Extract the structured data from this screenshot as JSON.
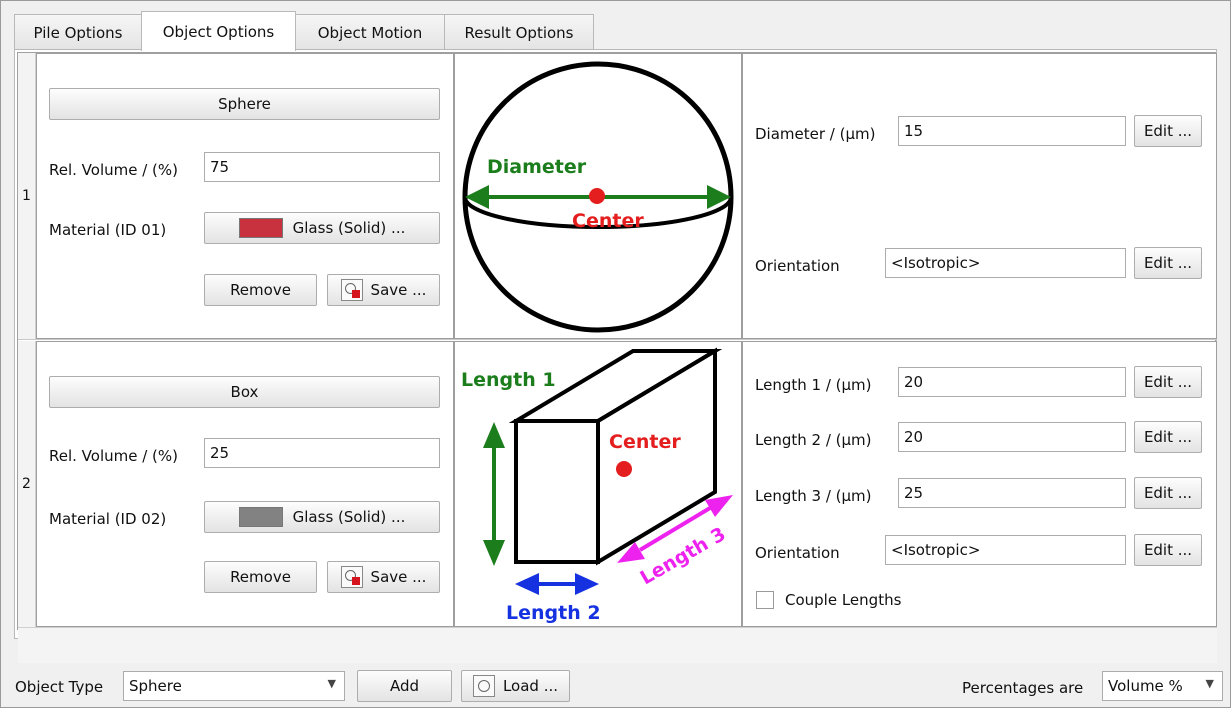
{
  "tabs": [
    {
      "label": "Pile Options"
    },
    {
      "label": "Object Options"
    },
    {
      "label": "Object Motion"
    },
    {
      "label": "Result Options"
    }
  ],
  "active_tab": "Object Options",
  "rows": [
    {
      "index": "1",
      "type_button": "Sphere",
      "rel_volume_label": "Rel. Volume / (%)",
      "rel_volume_value": "75",
      "material_label": "Material (ID 01)",
      "material_value": "Glass (Solid) ...",
      "material_color": "#c8323f",
      "remove_label": "Remove",
      "save_label": "Save ...",
      "diagram": {
        "diameter": "Diameter",
        "center": "Center"
      },
      "params": [
        {
          "label": "Diameter / (µm)",
          "value": "15",
          "edit": "Edit ..."
        },
        {
          "label": "Orientation",
          "value": "<Isotropic>",
          "edit": "Edit ..."
        }
      ]
    },
    {
      "index": "2",
      "type_button": "Box",
      "rel_volume_label": "Rel. Volume / (%)",
      "rel_volume_value": "25",
      "material_label": "Material (ID 02)",
      "material_value": "Glass (Solid) ...",
      "material_color": "#828282",
      "remove_label": "Remove",
      "save_label": "Save ...",
      "diagram": {
        "length1": "Length 1",
        "length2": "Length 2",
        "length3": "Length 3",
        "center": "Center"
      },
      "params": [
        {
          "label": "Length 1 / (µm)",
          "value": "20",
          "edit": "Edit ..."
        },
        {
          "label": "Length 2 / (µm)",
          "value": "20",
          "edit": "Edit ..."
        },
        {
          "label": "Length 3 / (µm)",
          "value": "25",
          "edit": "Edit ..."
        },
        {
          "label": "Orientation",
          "value": "<Isotropic>",
          "edit": "Edit ..."
        }
      ],
      "couple_lengths_label": "Couple Lengths",
      "couple_lengths_checked": false
    }
  ],
  "footer": {
    "object_type_label": "Object Type",
    "object_type_value": "Sphere",
    "add_label": "Add",
    "load_label": "Load ...",
    "percentages_label": "Percentages are",
    "percentages_value": "Volume %"
  },
  "colors": {
    "diagram_green": "#1b7d1b",
    "diagram_red": "#e41e1e",
    "diagram_blue": "#1531e0",
    "diagram_magenta": "#ee22ee"
  },
  "icons": {
    "save": "save-file-icon",
    "load": "load-file-icon",
    "dropdown": "chevron-down-icon"
  }
}
